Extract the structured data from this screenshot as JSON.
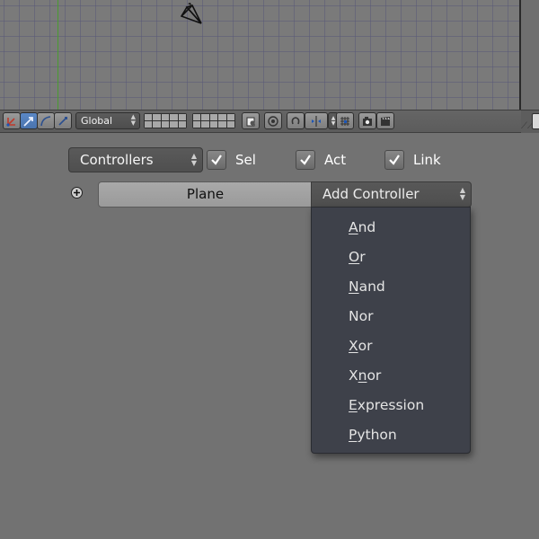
{
  "viewport": {
    "orientation_label": "Global",
    "colors": {
      "grid_bg": "#7a7a7a",
      "y_axis": "#4a9b30"
    }
  },
  "header": {
    "icons": [
      "manipulator-icon",
      "translate-icon",
      "rotate-icon",
      "scale-icon"
    ],
    "active_icon": "translate-icon",
    "extra_icons": [
      "lock-layers-icon",
      "pivot-icon",
      "snap-icon",
      "snap-element-icon",
      "proportional-icon",
      "render-camera-icon",
      "clapper-icon"
    ]
  },
  "logic": {
    "type_select": "Controllers",
    "checks": [
      {
        "label": "Sel",
        "checked": true
      },
      {
        "label": "Act",
        "checked": true
      },
      {
        "label": "Link",
        "checked": true
      }
    ],
    "object_name": "Plane",
    "add_button": "Add Controller"
  },
  "menu": {
    "items": [
      {
        "key": "A",
        "rest": "nd"
      },
      {
        "key": "O",
        "rest": "r"
      },
      {
        "key": "N",
        "rest": "and"
      },
      {
        "pre": "Nor",
        "key": " ",
        "rest": ""
      },
      {
        "key": "X",
        "rest": "or"
      },
      {
        "pre": "X",
        "key": "n",
        "rest": "or"
      },
      {
        "key": "E",
        "rest": "xpression"
      },
      {
        "key": "P",
        "rest": "ython"
      }
    ]
  }
}
